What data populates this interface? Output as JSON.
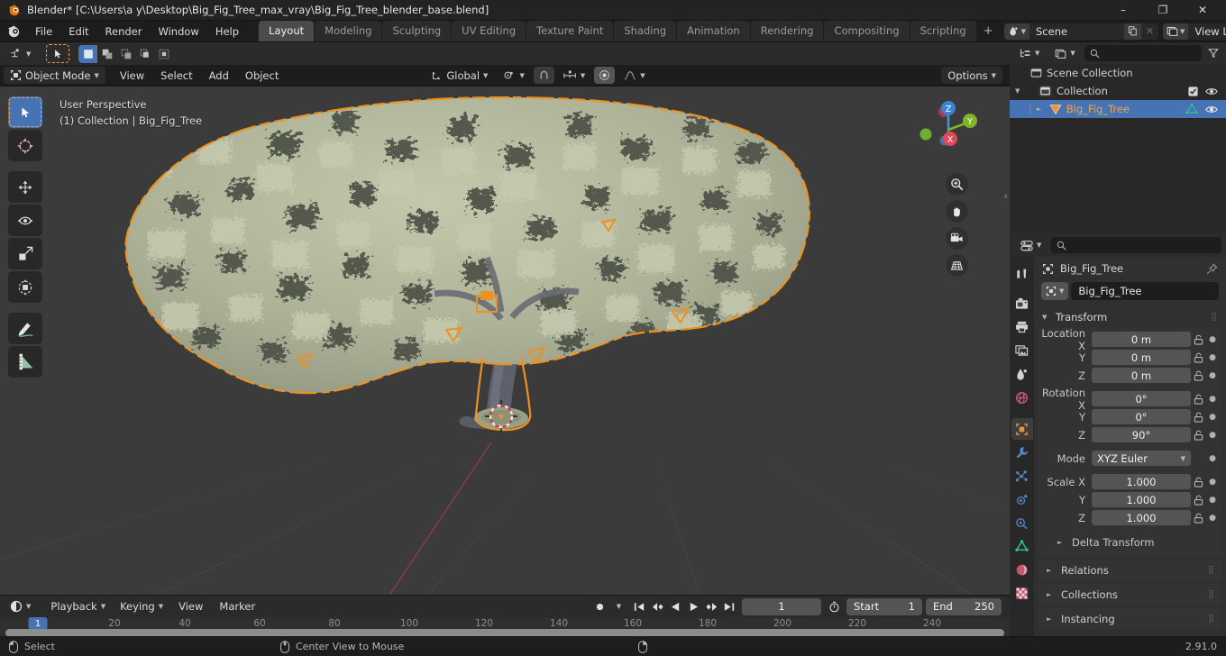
{
  "titlebar": {
    "title": "Blender* [C:\\Users\\a y\\Desktop\\Big_Fig_Tree_max_vray\\Big_Fig_Tree_blender_base.blend]",
    "minimize": "–",
    "maximize": "❐",
    "close": "✕"
  },
  "topbar": {
    "menus": [
      "File",
      "Edit",
      "Render",
      "Window",
      "Help"
    ],
    "workspaces": [
      {
        "label": "Layout",
        "active": true
      },
      {
        "label": "Modeling",
        "active": false
      },
      {
        "label": "Sculpting",
        "active": false
      },
      {
        "label": "UV Editing",
        "active": false
      },
      {
        "label": "Texture Paint",
        "active": false
      },
      {
        "label": "Shading",
        "active": false
      },
      {
        "label": "Animation",
        "active": false
      },
      {
        "label": "Rendering",
        "active": false
      },
      {
        "label": "Compositing",
        "active": false
      },
      {
        "label": "Scripting",
        "active": false
      }
    ],
    "add_workspace": "+",
    "scene_name": "Scene",
    "view_layer_name": "View Layer"
  },
  "viewport_header": {
    "mode": "Object Mode",
    "menus": [
      "View",
      "Select",
      "Add",
      "Object"
    ],
    "transform_orientation": "Global",
    "options": "Options"
  },
  "viewport": {
    "perspective": "User Perspective",
    "collection_info": "(1) Collection | Big_Fig_Tree",
    "gizmo_axes": [
      "Z",
      "Y",
      "X"
    ],
    "colors": {
      "background": "#3b3b3b",
      "foliage": "#b8bda2",
      "foliage_shadow": "#4e5248",
      "trunk": "#5f6068",
      "selection_outline": "#ed9121",
      "axis_x": "#e05a6a",
      "axis_y": "#8bc34a",
      "axis_z": "#4a90d9"
    }
  },
  "outliner": {
    "search_placeholder": "",
    "rows": [
      {
        "label": "Scene Collection",
        "icon": "collection-icon",
        "depth": 0,
        "selected": false,
        "expandable": false,
        "checkbox": false,
        "eye": false
      },
      {
        "label": "Collection",
        "icon": "collection-icon",
        "depth": 1,
        "selected": false,
        "expandable": true,
        "checkbox": true,
        "eye": true
      },
      {
        "label": "Big_Fig_Tree",
        "icon": "mesh-object-icon",
        "depth": 2,
        "selected": true,
        "expandable": true,
        "checkbox": false,
        "eye": true
      }
    ]
  },
  "properties": {
    "search_placeholder": "",
    "breadcrumb": "Big_Fig_Tree",
    "object_name": "Big_Fig_Tree",
    "tabs": [
      {
        "name": "tool-tab",
        "active": false
      },
      {
        "name": "render-tab",
        "active": false
      },
      {
        "name": "output-tab",
        "active": false
      },
      {
        "name": "view-layer-tab",
        "active": false
      },
      {
        "name": "scene-tab",
        "active": false
      },
      {
        "name": "world-tab",
        "active": false
      },
      {
        "name": "object-tab",
        "active": true
      },
      {
        "name": "modifier-tab",
        "active": false
      },
      {
        "name": "particles-tab",
        "active": false
      },
      {
        "name": "physics-tab",
        "active": false
      },
      {
        "name": "constraints-tab",
        "active": false
      },
      {
        "name": "object-data-tab",
        "active": false
      },
      {
        "name": "material-tab",
        "active": false
      },
      {
        "name": "texture-tab",
        "active": false
      }
    ],
    "transform": {
      "title": "Transform",
      "location": {
        "label": "Location X",
        "x": "0 m",
        "y": "0 m",
        "z": "0 m"
      },
      "rotation": {
        "label": "Rotation X",
        "x": "0°",
        "y": "0°",
        "z": "90°"
      },
      "mode": {
        "label": "Mode",
        "value": "XYZ Euler"
      },
      "scale": {
        "label": "Scale X",
        "x": "1.000",
        "y": "1.000",
        "z": "1.000"
      },
      "axis_y": "Y",
      "axis_z": "Z"
    },
    "closed_panels": [
      "Delta Transform",
      "Relations",
      "Collections",
      "Instancing"
    ]
  },
  "timeline": {
    "menus": [
      "Playback",
      "Keying",
      "View",
      "Marker"
    ],
    "current_frame": "1",
    "start_label": "Start",
    "start_value": "1",
    "end_label": "End",
    "end_value": "250",
    "ticks": [
      "20",
      "40",
      "60",
      "80",
      "100",
      "120",
      "140",
      "160",
      "180",
      "200",
      "220",
      "240"
    ],
    "playhead_label": "1"
  },
  "statusbar": {
    "items": [
      {
        "label": "Select",
        "mouse": "left"
      },
      {
        "label": "Center View to Mouse",
        "mouse": "middle"
      },
      {
        "label": "",
        "mouse": "right"
      }
    ],
    "version": "2.91.0"
  }
}
